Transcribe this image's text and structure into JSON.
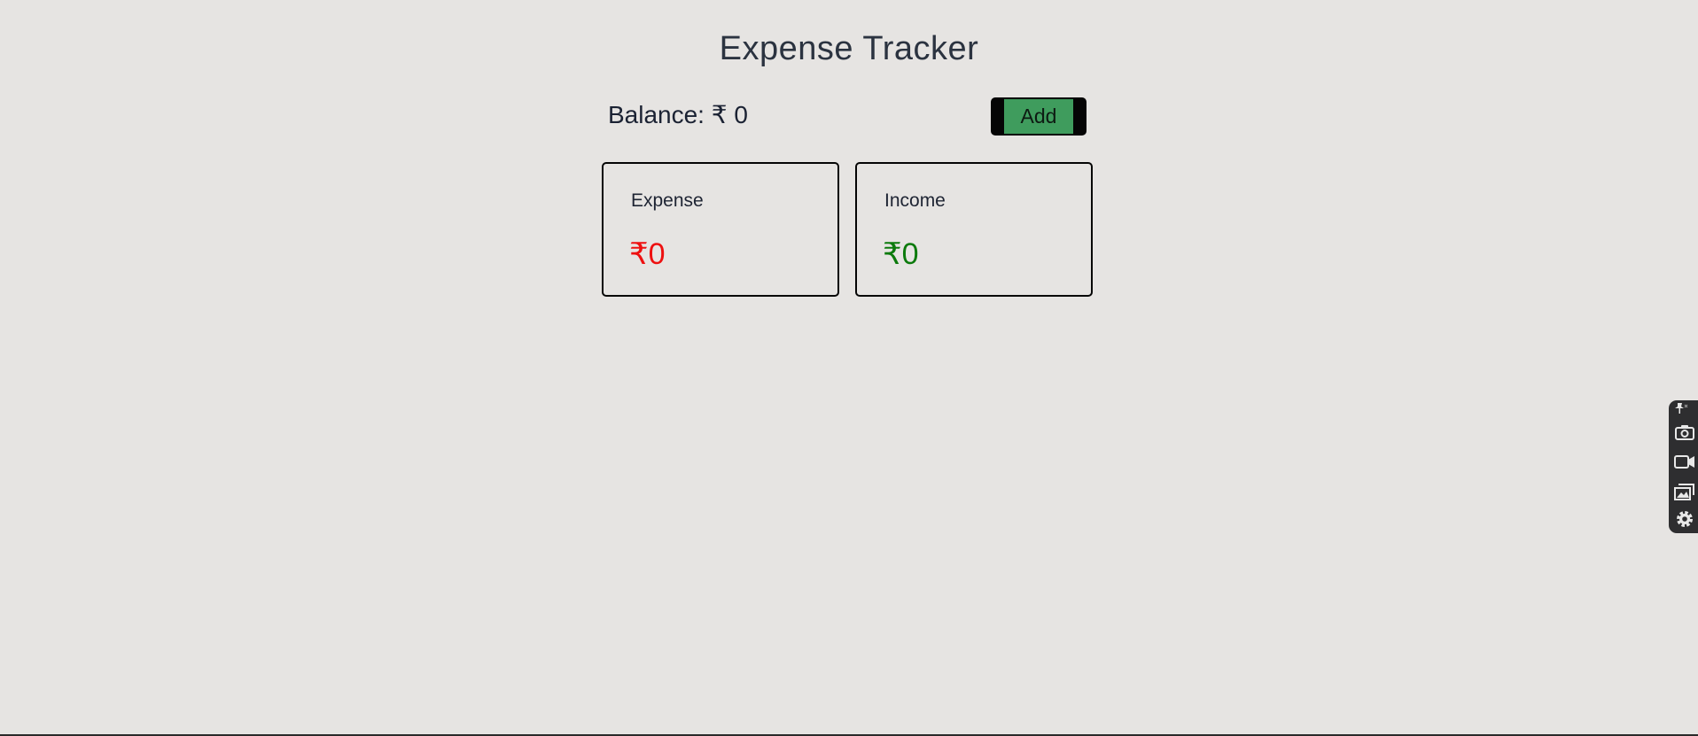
{
  "app": {
    "title": "Expense Tracker"
  },
  "summary": {
    "balance_text": "Balance: ₹ 0",
    "add_label": "Add"
  },
  "cards": {
    "expense": {
      "label": "Expense",
      "amount": "₹0",
      "color": "#ee1010"
    },
    "income": {
      "label": "Income",
      "amount": "₹0",
      "color": "#0c7a0c"
    }
  },
  "colors": {
    "background": "#e6e4e2",
    "add_button": "#3f9c5d"
  },
  "side_toolbar": {
    "icons": [
      "pin-icon",
      "camera-icon",
      "video-camera-icon",
      "gallery-icon",
      "settings-gear-icon"
    ]
  }
}
